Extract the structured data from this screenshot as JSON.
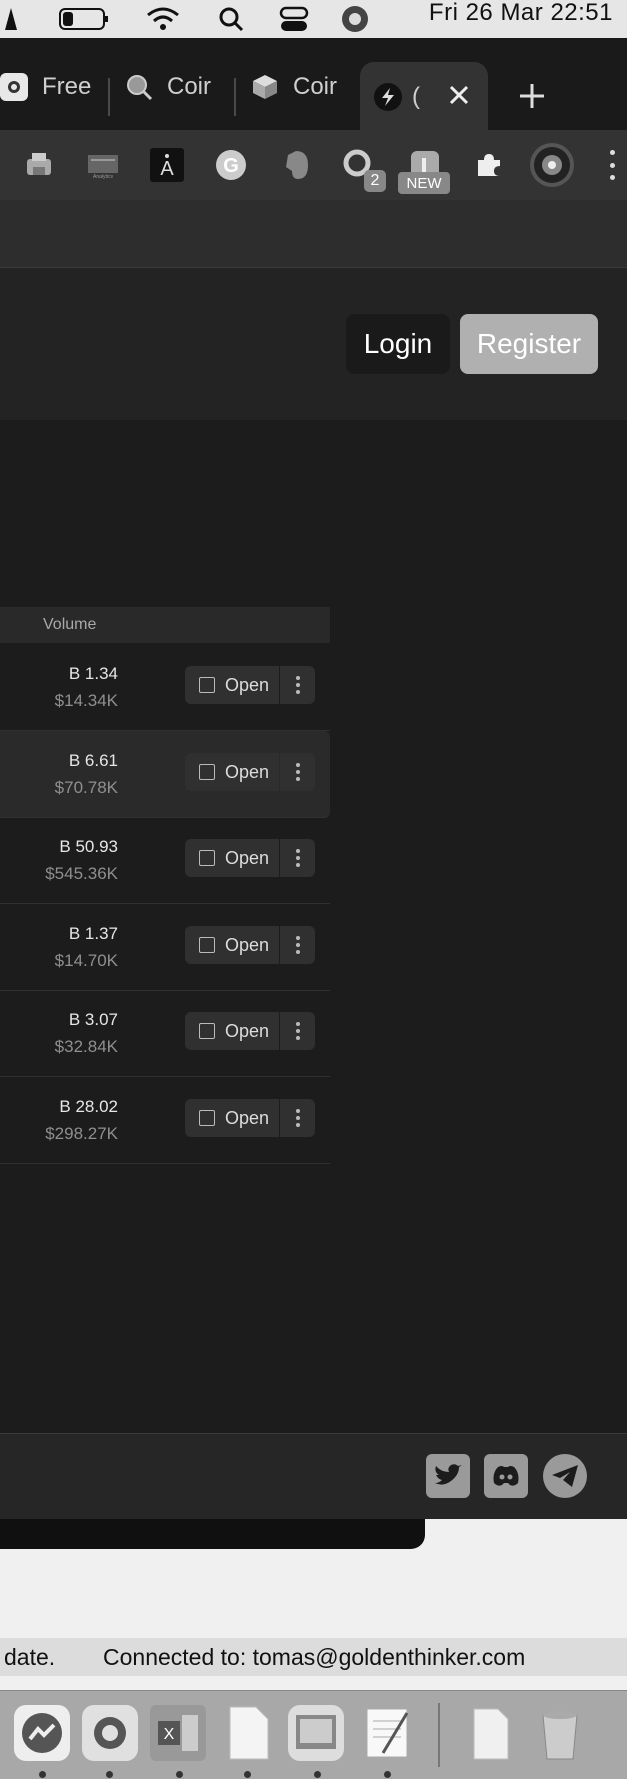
{
  "menubar": {
    "datetime": "Fri 26 Mar  22:51"
  },
  "tabs": [
    {
      "label": "Free",
      "icon": "app-icon"
    },
    {
      "label": "Coir",
      "icon": "magnifier-coin-icon"
    },
    {
      "label": "Coir",
      "icon": "cube-icon"
    },
    {
      "label": "(",
      "icon": "bolt-icon",
      "active": true
    }
  ],
  "toolbar": {
    "extensions": [
      {
        "icon": "printer-icon"
      },
      {
        "icon": "analytics-icon",
        "label": "Analytics"
      },
      {
        "icon": "a-tower-icon",
        "label": "A"
      },
      {
        "icon": "grammarly-icon",
        "label": "G"
      },
      {
        "icon": "evernote-icon"
      },
      {
        "icon": "ring-icon",
        "badge": "2"
      },
      {
        "icon": "new-extension-icon",
        "badge": "NEW"
      },
      {
        "icon": "puzzle-icon"
      },
      {
        "icon": "profile-avatar-icon"
      }
    ]
  },
  "header": {
    "login_label": "Login",
    "register_label": "Register"
  },
  "table": {
    "column_header": "Volume",
    "rows": [
      {
        "volume": "B 1.34",
        "usd": "$14.34K",
        "open_label": "Open"
      },
      {
        "volume": "B 6.61",
        "usd": "$70.78K",
        "open_label": "Open"
      },
      {
        "volume": "B 50.93",
        "usd": "$545.36K",
        "open_label": "Open"
      },
      {
        "volume": "B 1.37",
        "usd": "$14.70K",
        "open_label": "Open"
      },
      {
        "volume": "B 3.07",
        "usd": "$32.84K",
        "open_label": "Open"
      },
      {
        "volume": "B 28.02",
        "usd": "$298.27K",
        "open_label": "Open"
      }
    ]
  },
  "footer": {
    "social": [
      "twitter-icon",
      "discord-icon",
      "telegram-icon"
    ]
  },
  "statusbar": {
    "left_text": "date.",
    "connected_text": "Connected to: tomas@goldenthinker.com"
  },
  "colors": {
    "accent_register": "#b0b0b0",
    "page_bg": "#1c1c1c"
  }
}
